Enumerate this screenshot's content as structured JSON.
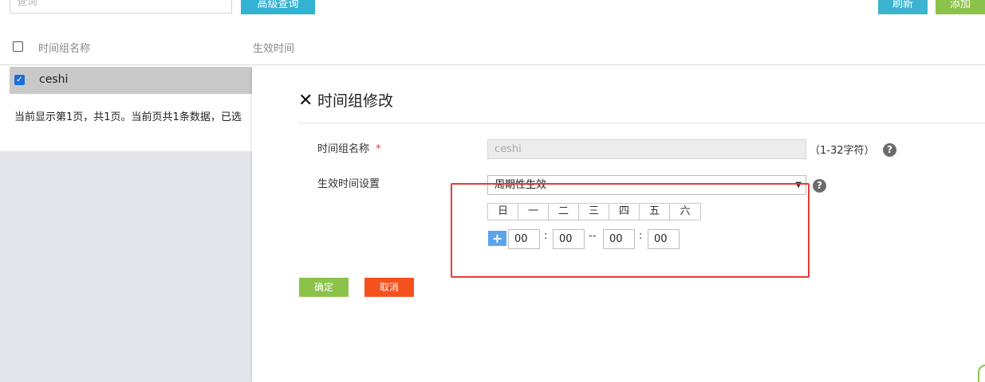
{
  "toolbar": {
    "search_placeholder": "查询",
    "advanced_search_label": "高级查询",
    "refresh_label": "刷新",
    "add_label": "添加"
  },
  "table": {
    "columns": [
      "时间组名称",
      "生效时间"
    ],
    "rows": [
      {
        "name": "ceshi",
        "checked": true
      }
    ],
    "paging_text": "当前显示第1页，共1页。当前页共1条数据，已选"
  },
  "modal": {
    "close_icon": "close-icon",
    "title": "时间组修改",
    "name_label": "时间组名称",
    "required_mark": "*",
    "name_value": "ceshi",
    "name_hint": "（1-32字符）",
    "help_glyph": "?",
    "effective_label": "生效时间设置",
    "effective_selected": "周期性生效",
    "weekdays": [
      "日",
      "一",
      "二",
      "三",
      "四",
      "五",
      "六"
    ],
    "add_time_glyph": "+",
    "time": {
      "start_hour": "00",
      "start_minute": "00",
      "end_hour": "00",
      "end_minute": "00",
      "colon": ":",
      "dash": "--"
    },
    "confirm_label": "确定",
    "cancel_label": "取消"
  },
  "colors": {
    "accent_blue": "#32b3d4",
    "accent_green": "#8bc34a",
    "danger": "#f4511e",
    "highlight_box": "#e53935"
  }
}
